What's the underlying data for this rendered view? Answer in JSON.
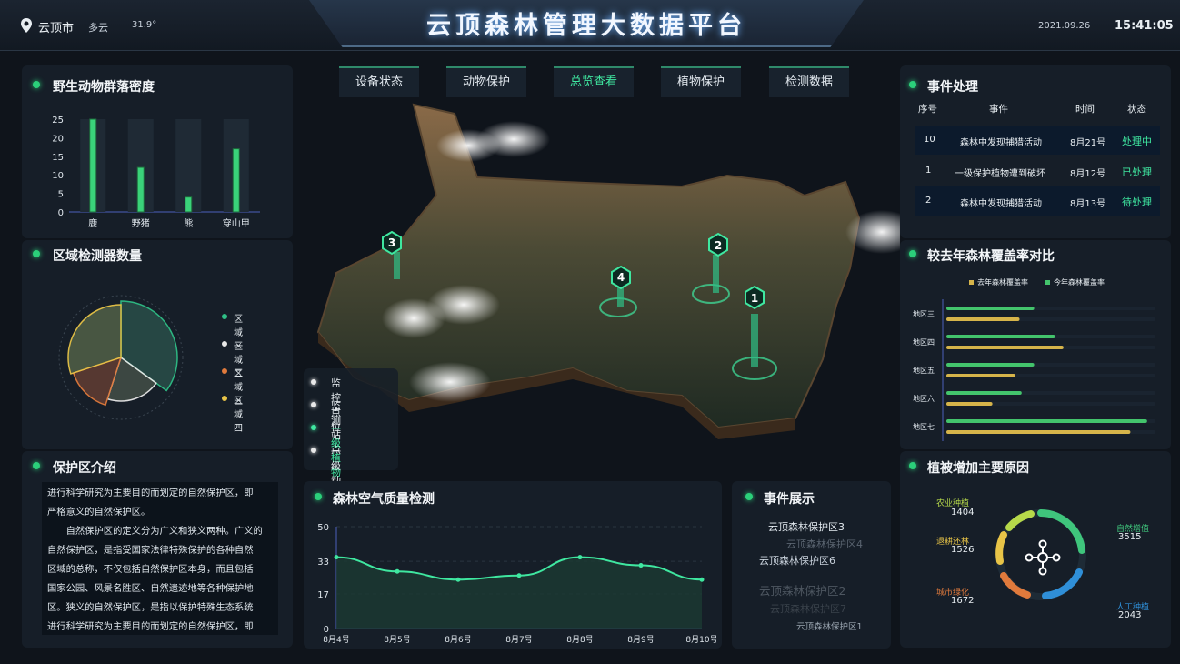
{
  "header": {
    "location": "云顶市",
    "weather": "多云",
    "temperature": "31.9°",
    "title": "云顶森林管理大数据平台",
    "date": "2021.09.26",
    "time": "15:41:05"
  },
  "nav": {
    "tabs": [
      "设备状态",
      "动物保护",
      "总览查看",
      "植物保护",
      "检测数据"
    ],
    "active_index": 2
  },
  "wildlife": {
    "title": "野生动物群落密度",
    "chart_data": {
      "type": "bar",
      "categories": [
        "鹿",
        "野猪",
        "熊",
        "穿山甲"
      ],
      "values": [
        25,
        12,
        4,
        17
      ],
      "ylim": [
        0,
        25
      ],
      "yticks": [
        0,
        5,
        10,
        15,
        20,
        25
      ]
    }
  },
  "detectors": {
    "title": "区域检测器数量",
    "legend": [
      "区域一",
      "区域二",
      "区域三",
      "区域四"
    ],
    "colors": [
      "#2fbf86",
      "#e8e8e8",
      "#e07a3c",
      "#e8c447"
    ],
    "chart_data": {
      "type": "pie",
      "labels": [
        "区域一",
        "区域二",
        "区域三",
        "区域四"
      ],
      "values": [
        35,
        20,
        15,
        30
      ]
    }
  },
  "intro": {
    "title": "保护区介绍",
    "lines": [
      "进行科学研究为主要目的而划定的自然保护区，即",
      "严格意义的自然保护区。",
      "　　自然保护区的定义分为广义和狭义两种。广义的",
      "自然保护区，是指受国家法律特殊保护的各种自然",
      "区域的总称，不仅包括自然保护区本身，而且包括",
      "国家公园、风景名胜区、自然遗迹地等各种保护地",
      "区。狭义的自然保护区，是指以保护特殊生态系统",
      "进行科学研究为主要目的而划定的自然保护区，即"
    ]
  },
  "map_legend": {
    "items": [
      "监控点位",
      "监测站点",
      "一级植物",
      "一级动物"
    ],
    "markers": [
      "1",
      "2",
      "3",
      "4"
    ]
  },
  "air": {
    "title": "森林空气质量检测",
    "chart_data": {
      "type": "line",
      "x": [
        "8月4号",
        "8月5号",
        "8月6号",
        "8月7号",
        "8月8号",
        "8月9号",
        "8月10号"
      ],
      "values": [
        35,
        28,
        24,
        26,
        35,
        31,
        24
      ],
      "ylim": [
        0,
        50
      ],
      "yticks": [
        0,
        17,
        33,
        50
      ]
    }
  },
  "events_show": {
    "title": "事件展示",
    "items": [
      "云顶森林保护区3",
      "云顶森林保护区4",
      "云顶森林保护区6",
      "云顶森林保护区2",
      "云顶森林保护区7",
      "云顶森林保护区1"
    ]
  },
  "events": {
    "title": "事件处理",
    "headers": [
      "序号",
      "事件",
      "时间",
      "状态"
    ],
    "rows": [
      {
        "no": "10",
        "event": "森林中发现捕猎活动",
        "time": "8月21号",
        "status": "处理中"
      },
      {
        "no": "1",
        "event": "一级保护植物遭到破坏",
        "time": "8月12号",
        "status": "已处理"
      },
      {
        "no": "2",
        "event": "森林中发现捕猎活动",
        "time": "8月13号",
        "status": "待处理"
      }
    ]
  },
  "coverage": {
    "title": "较去年森林覆盖率对比",
    "legend": [
      "去年森林覆盖率",
      "今年森林覆盖率"
    ],
    "colors": [
      "#d6b44a",
      "#43c46c"
    ],
    "chart_data": {
      "type": "bar",
      "orientation": "horizontal",
      "categories": [
        "地区三",
        "地区四",
        "地区五",
        "地区六",
        "地区七"
      ],
      "series": [
        {
          "name": "去年森林覆盖率",
          "values": [
            35,
            56,
            33,
            22,
            88
          ]
        },
        {
          "name": "今年森林覆盖率",
          "values": [
            42,
            52,
            42,
            36,
            96
          ]
        }
      ],
      "xlim": [
        0,
        100
      ]
    }
  },
  "vegetation": {
    "title": "植被增加主要原因",
    "items": [
      {
        "label": "农业种植",
        "value": "1404",
        "color": "#b6d94a"
      },
      {
        "label": "退耕还林",
        "value": "1526",
        "color": "#e8c447"
      },
      {
        "label": "城市绿化",
        "value": "1672",
        "color": "#e07a3c"
      },
      {
        "label": "自然增值",
        "value": "3515",
        "color": "#3fc57c"
      },
      {
        "label": "人工种植",
        "value": "2043",
        "color": "#2f8fd8"
      }
    ]
  }
}
